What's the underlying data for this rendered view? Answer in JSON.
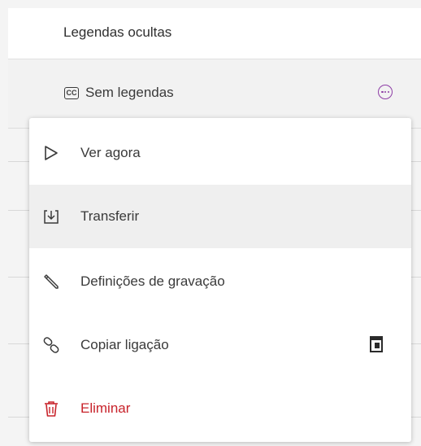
{
  "table": {
    "header_label": "Legendas ocultas",
    "row": {
      "cc_badge": "CC",
      "caption_status": "Sem legendas",
      "more_icon": "more-options-icon"
    }
  },
  "context_menu": {
    "items": [
      {
        "label": "Ver agora",
        "icon": "play-icon"
      },
      {
        "label": "Transferir",
        "icon": "download-icon"
      },
      {
        "label": "Definições de gravação",
        "icon": "pencil-icon"
      },
      {
        "label": "Copiar ligação",
        "icon": "link-icon",
        "trailing_icon": "clipboard-icon"
      },
      {
        "label": "Eliminar",
        "icon": "trash-icon"
      }
    ]
  },
  "colors": {
    "accent": "#8e3ea6",
    "danger": "#c8232b",
    "hover_bg": "#efefef"
  }
}
